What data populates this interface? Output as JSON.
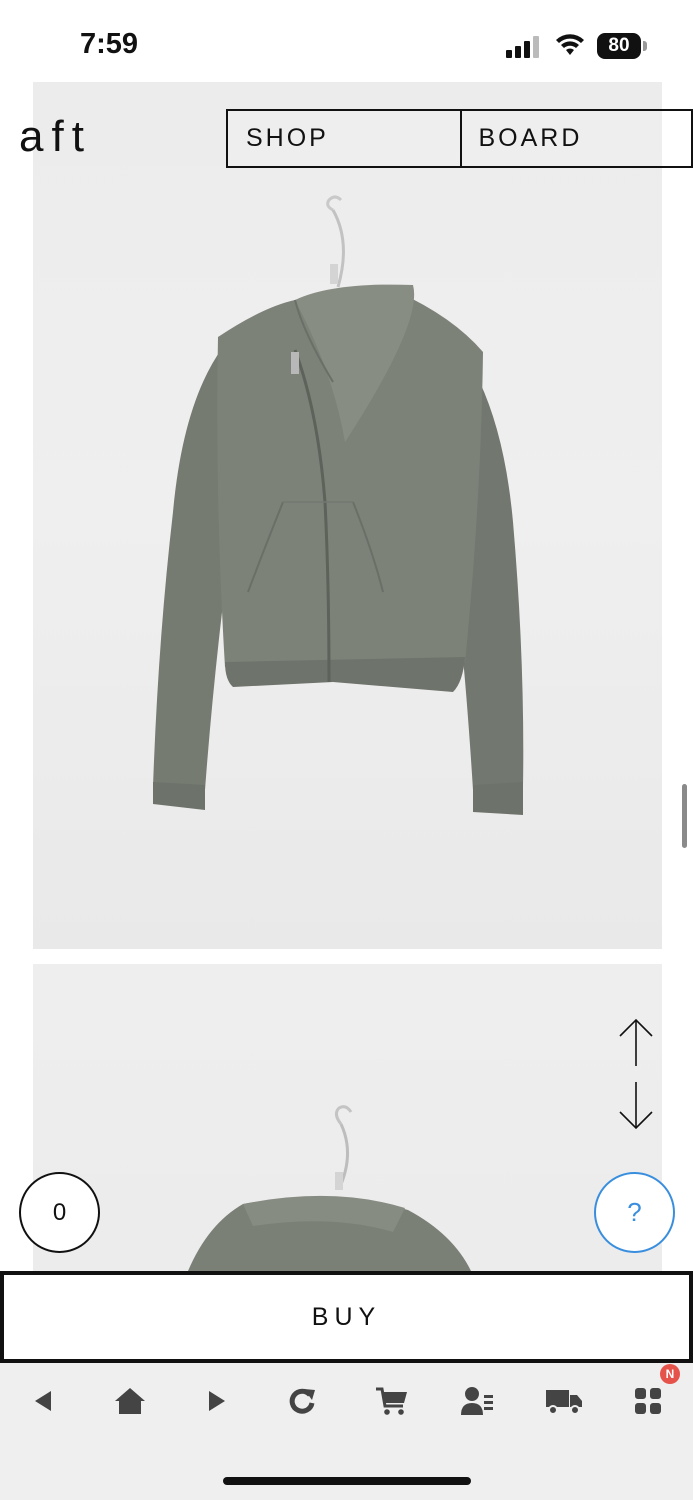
{
  "status_bar": {
    "time": "7:59",
    "battery": "80"
  },
  "header": {
    "logo": "aft",
    "nav": [
      {
        "label": "SHOP"
      },
      {
        "label": "BOARD"
      }
    ]
  },
  "product": {
    "colors": {
      "jacket": "#7b7f76",
      "background": "#ececec"
    }
  },
  "floating": {
    "cart_count": "0",
    "help_label": "?"
  },
  "buy": {
    "label": "BUY"
  },
  "toolbar": {
    "items": [
      "back-icon",
      "home-icon",
      "forward-icon",
      "refresh-icon",
      "cart-icon",
      "account-icon",
      "delivery-icon",
      "apps-icon"
    ],
    "badge": "N",
    "accent": "#3a8ede",
    "badge_color": "#e5534b"
  }
}
